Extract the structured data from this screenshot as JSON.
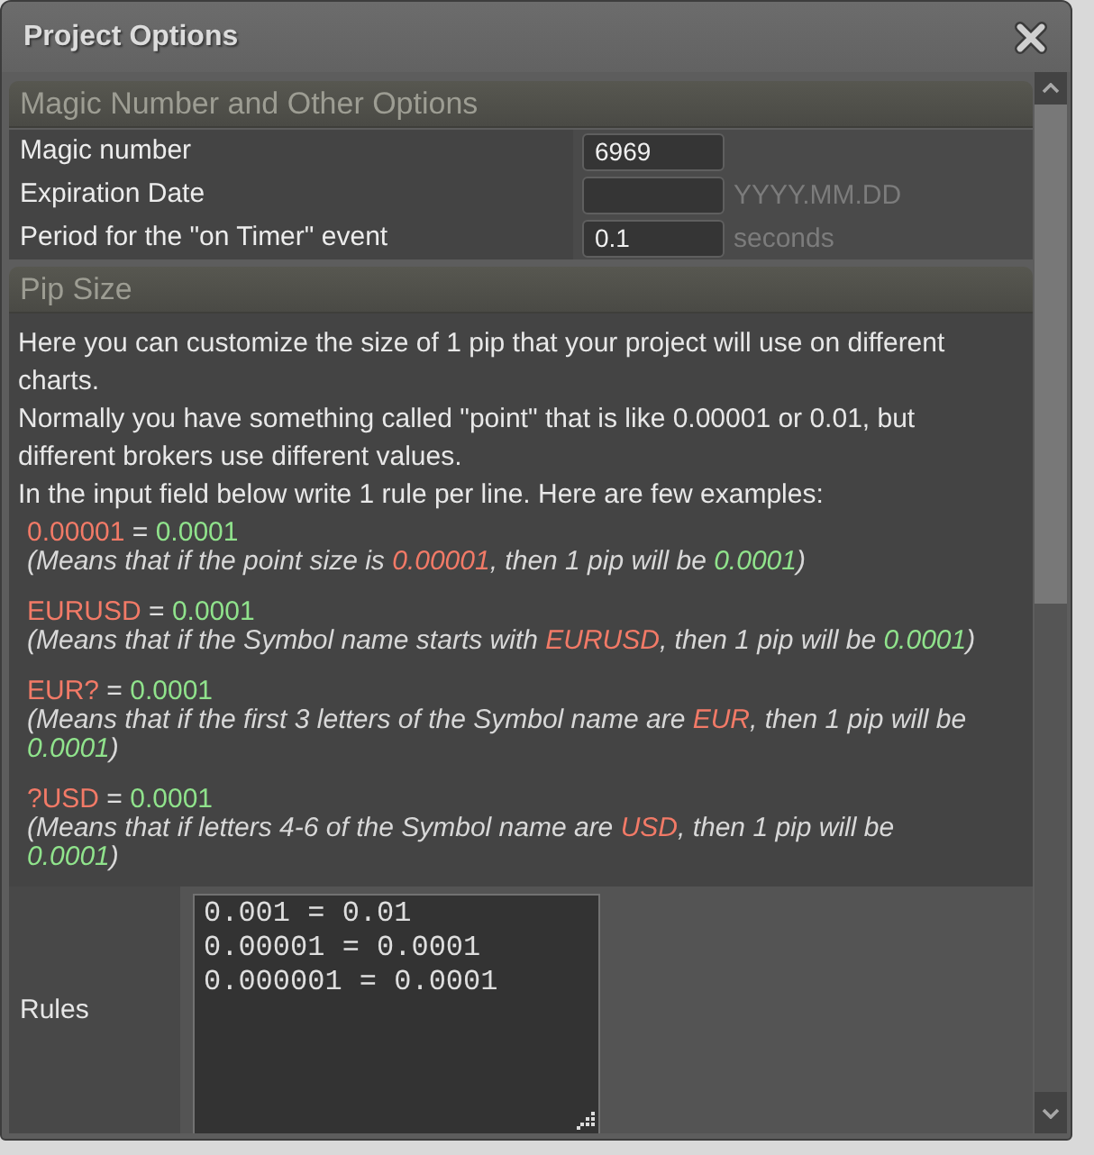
{
  "window": {
    "title": "Project Options"
  },
  "sections": [
    {
      "kind": "form",
      "title": "Magic Number and Other Options",
      "fields": [
        {
          "label": "Magic number",
          "value": "6969"
        },
        {
          "label": "Expiration Date",
          "suffix": "YYYY.MM.DD"
        },
        {
          "label": "Period for the \"on Timer\" event",
          "value": "0.1",
          "suffix": "seconds"
        }
      ]
    },
    {
      "kind": "pip",
      "title": "Pip Size",
      "paragraphs": [
        "Here you can customize the size of 1 pip that your project will use on different charts.",
        "Normally you have something called \"point\" that is like 0.00001 or 0.01, but different brokers use different values.",
        "In the input field below write 1 rule per line. Here are few examples:"
      ],
      "examples": [
        {
          "rule": [
            {
              "kind": "pattern",
              "text": "0.00001"
            },
            {
              "kind": "text",
              "text": " = "
            },
            {
              "kind": "pip",
              "text": "0.0001"
            }
          ],
          "note": [
            {
              "kind": "text",
              "text": "(Means that if the point size is "
            },
            {
              "kind": "pattern",
              "text": "0.00001"
            },
            {
              "kind": "text",
              "text": ", then 1 pip will be "
            },
            {
              "kind": "pip",
              "text": "0.0001"
            },
            {
              "kind": "text",
              "text": ")"
            }
          ]
        },
        {
          "rule": [
            {
              "kind": "pattern",
              "text": "EURUSD"
            },
            {
              "kind": "text",
              "text": " = "
            },
            {
              "kind": "pip",
              "text": "0.0001"
            }
          ],
          "note": [
            {
              "kind": "text",
              "text": "(Means that if the Symbol name starts with "
            },
            {
              "kind": "pattern",
              "text": "EURUSD"
            },
            {
              "kind": "text",
              "text": ", then 1 pip will be "
            },
            {
              "kind": "pip",
              "text": "0.0001"
            },
            {
              "kind": "text",
              "text": ")"
            }
          ]
        },
        {
          "rule": [
            {
              "kind": "pattern",
              "text": "EUR?"
            },
            {
              "kind": "text",
              "text": " = "
            },
            {
              "kind": "pip",
              "text": "0.0001"
            }
          ],
          "note": [
            {
              "kind": "text",
              "text": "(Means that if the first 3 letters of the Symbol name are "
            },
            {
              "kind": "pattern",
              "text": "EUR"
            },
            {
              "kind": "text",
              "text": ", then 1 pip will be "
            },
            {
              "kind": "pip",
              "text": "0.0001"
            },
            {
              "kind": "text",
              "text": ")"
            }
          ]
        },
        {
          "rule": [
            {
              "kind": "pattern",
              "text": "?USD"
            },
            {
              "kind": "text",
              "text": " = "
            },
            {
              "kind": "pip",
              "text": "0.0001"
            }
          ],
          "note": [
            {
              "kind": "text",
              "text": "(Means that if letters 4-6 of the Symbol name are "
            },
            {
              "kind": "pattern",
              "text": "USD"
            },
            {
              "kind": "text",
              "text": ", then 1 pip will be "
            },
            {
              "kind": "pip",
              "text": "0.0001"
            },
            {
              "kind": "text",
              "text": ")"
            }
          ]
        }
      ],
      "rules_field": {
        "label": "Rules",
        "lines": [
          "0.001 = 0.01",
          "0.00001 = 0.0001",
          "0.000001 = 0.0001"
        ]
      }
    }
  ]
}
